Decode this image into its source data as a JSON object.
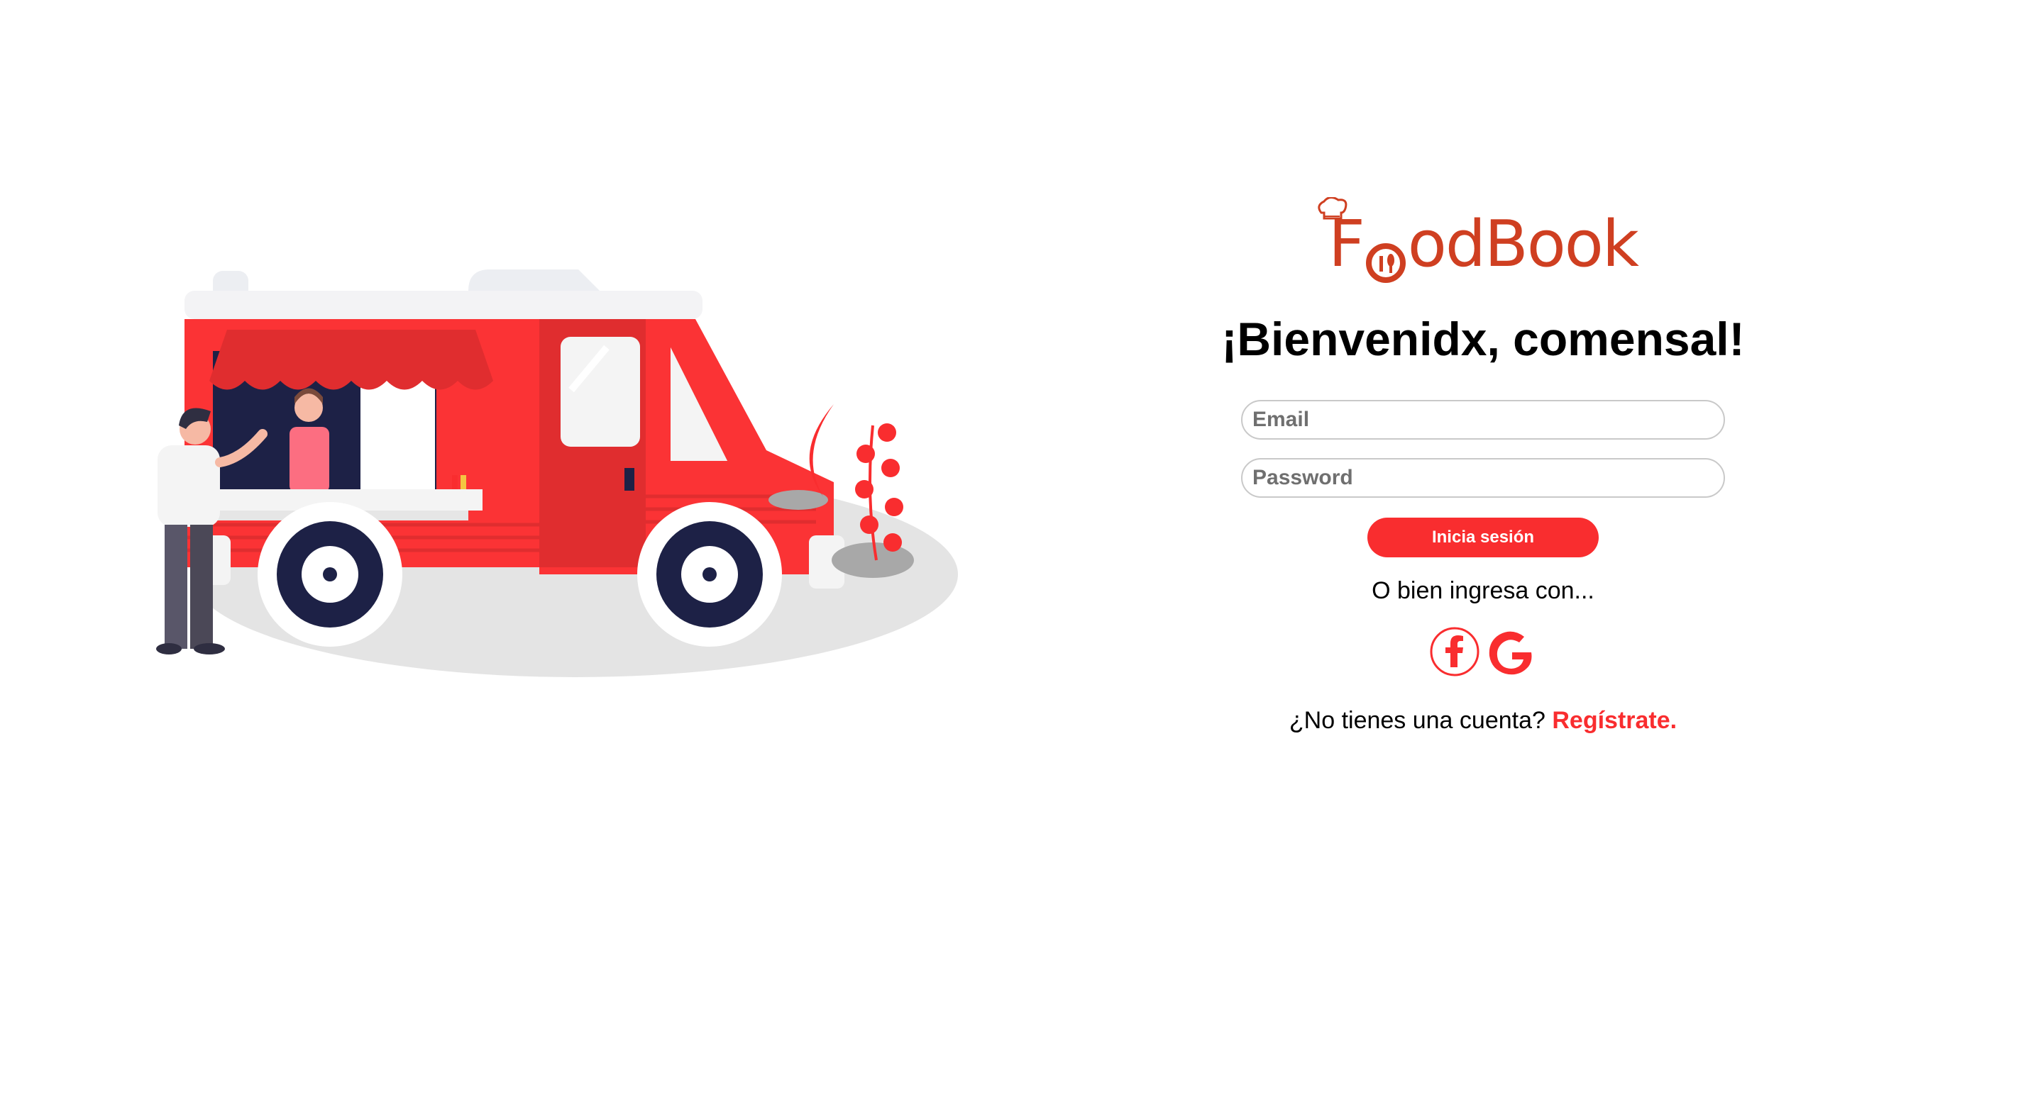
{
  "brand": {
    "name_prefix": "F",
    "name_suffix": "odBook",
    "color": "#cf3f21"
  },
  "accent_color": "#f92d2f",
  "welcome_title": "¡Bienvenidx, comensal!",
  "form": {
    "email_placeholder": "Email",
    "password_placeholder": "Password",
    "login_button": "Inicia sesión"
  },
  "alt_login_text": "O bien ingresa con...",
  "social": {
    "facebook_icon": "facebook-icon",
    "google_icon": "google-icon"
  },
  "signup": {
    "prompt": "¿No tienes una cuenta?",
    "link": "Regístrate."
  },
  "illustration": {
    "icon": "food-truck-illustration"
  }
}
